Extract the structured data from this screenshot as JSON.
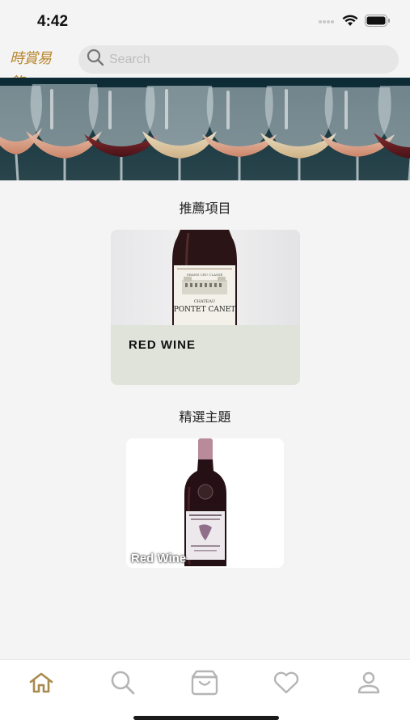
{
  "status_bar": {
    "time": "4:42"
  },
  "header": {
    "logo_text": "時賞易飽",
    "search": {
      "placeholder": "Search",
      "value": ""
    }
  },
  "sections": {
    "recommended": {
      "title": "推薦項目",
      "card": {
        "label": "RED WINE",
        "bottle_label_top": "CHATEAU",
        "bottle_label_main": "PONTET CANET"
      }
    },
    "featured": {
      "title": "精選主題",
      "card": {
        "label": "Red Wine"
      }
    }
  },
  "tab_bar": {
    "items": [
      {
        "icon": "home-icon",
        "active": true
      },
      {
        "icon": "search-icon",
        "active": false
      },
      {
        "icon": "bag-icon",
        "active": false
      },
      {
        "icon": "heart-icon",
        "active": false
      },
      {
        "icon": "profile-icon",
        "active": false
      }
    ]
  },
  "colors": {
    "accent": "#a88a4e",
    "inactive_icon": "#b5b5b5",
    "background": "#f4f4f4",
    "rec_card_bg": "#dfe3da"
  }
}
